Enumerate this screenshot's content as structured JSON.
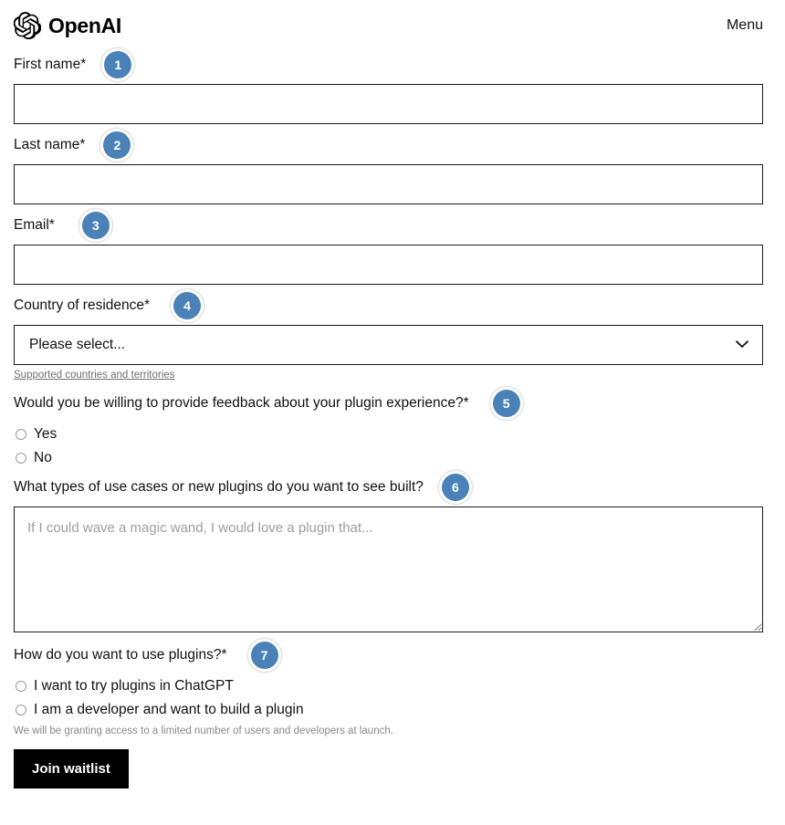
{
  "header": {
    "brand_name": "OpenAI",
    "logo_icon": "openai-logo-icon",
    "menu_label": "Menu"
  },
  "form": {
    "fields": [
      {
        "badge": "1",
        "label": "First name*",
        "type": "text",
        "value": "",
        "placeholder": ""
      },
      {
        "badge": "2",
        "label": "Last name*",
        "type": "text",
        "value": "",
        "placeholder": ""
      },
      {
        "badge": "3",
        "label": "Email*",
        "type": "text",
        "value": "",
        "placeholder": ""
      },
      {
        "badge": "4",
        "label": "Country of residence*",
        "type": "select",
        "selected": "Please select...",
        "chevron_icon": "chevron-down-icon",
        "help_link": "Supported countries and territories"
      },
      {
        "badge": "5",
        "label": "Would you be willing to provide feedback about your plugin experience?*",
        "type": "radio",
        "options": [
          "Yes",
          "No"
        ]
      },
      {
        "badge": "6",
        "label": "What types of use cases or new plugins do you want to see built?",
        "type": "textarea",
        "value": "",
        "placeholder": "If I could wave a magic wand, I would love a plugin that..."
      },
      {
        "badge": "7",
        "label": "How do you want to use plugins?*",
        "type": "radio",
        "options": [
          "I want to try plugins in ChatGPT",
          "I am a developer and want to build a plugin"
        ],
        "note": "We will be granting access to a limited number of users and developers at launch."
      }
    ],
    "submit_label": "Join waitlist"
  },
  "colors": {
    "badge_blue": "#4a82b8",
    "button_black": "#000000",
    "border_black": "#1a1a1a",
    "placeholder_gray": "#9e9e9e"
  }
}
